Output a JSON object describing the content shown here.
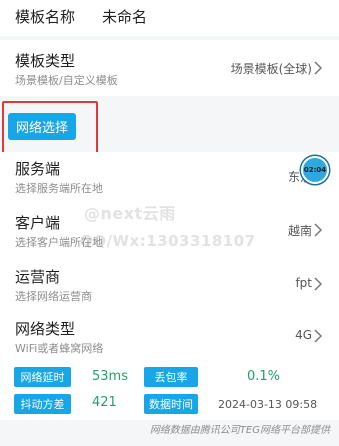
{
  "template_name": {
    "label": "模板名称",
    "value": "未命名"
  },
  "template_type": {
    "title": "模板类型",
    "subtitle": "场景模板/自定义模板",
    "value": "场景模板(全球)"
  },
  "network_select_button": "网络选择",
  "rows": [
    {
      "title": "服务端",
      "subtitle": "选择服务端所在地",
      "value": "东京"
    },
    {
      "title": "客户端",
      "subtitle": "选择客户端所在地",
      "value": "越南"
    },
    {
      "title": "运营商",
      "subtitle": "选择网络运营商",
      "value": "fpt"
    },
    {
      "title": "网络类型",
      "subtitle": "WiFi或者蜂窝网络",
      "value": "4G"
    }
  ],
  "float_badge": "02:04",
  "watermark": {
    "line1": "@next云雨",
    "line2": "QQ/Wx:1303318107"
  },
  "stats": {
    "latency_label": "网络延时",
    "latency_value": "53ms",
    "loss_label": "丢包率",
    "loss_value": "0.1%",
    "jitter_label": "抖动方差",
    "jitter_value": "421",
    "time_label": "数据时间",
    "time_value": "2024-03-13 09:58"
  },
  "footer": "网络数据由腾讯公司TEG网络平台部提供",
  "colors": {
    "accent": "#18a7e6",
    "highlight_box": "#e23a3a",
    "stat_value": "#22a06b"
  }
}
